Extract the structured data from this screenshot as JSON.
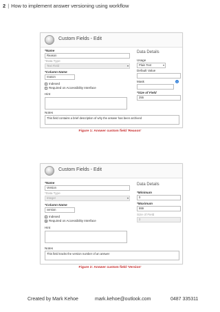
{
  "header": {
    "page_number": "2",
    "separator": "|",
    "title": "How to implement answer versioning using workflow"
  },
  "figures": [
    {
      "window_title": "Custom Fields - Edit",
      "name_label": "*Name",
      "name_value": "Reason",
      "data_type_label": "*Data Type",
      "data_type_value": "Text Field",
      "column_name_label": "*Column Name",
      "column_name_value": "reason",
      "indexed_label": "Indexed",
      "indexed_checked": false,
      "required_label": "Required on Accessibility Interface",
      "required_checked": false,
      "hint_label": "Hint",
      "hint_value": "",
      "notes_label": "Notes",
      "notes_value": "This field contains a brief description of why the answer has been archived",
      "data_details_title": "Data Details",
      "usage_label": "Usage",
      "usage_value": "Plain Text",
      "default_value_label": "Default Value",
      "default_value_value": "",
      "mask_label": "Mask",
      "mask_value": "",
      "mask_info_icon": "info-icon",
      "size_label": "*Size of Field",
      "size_value": "255",
      "caption": "Figure 1: Answer custom field 'Reason'"
    },
    {
      "window_title": "Custom Fields - Edit",
      "name_label": "*Name",
      "name_value": "Version",
      "data_type_label": "*Data Type",
      "data_type_value": "Integer",
      "column_name_label": "*Column Name",
      "column_name_value": "version",
      "indexed_label": "Indexed",
      "indexed_checked": false,
      "required_label": "Required on Accessibility Interface",
      "required_checked": true,
      "hint_label": "Hint",
      "hint_value": "",
      "notes_label": "Notes",
      "notes_value": "This field tracks the version number of an answer",
      "data_details_title": "Data Details",
      "minimum_label": "*Minimum",
      "minimum_value": "0",
      "maximum_label": "*Maximum",
      "maximum_value": "999",
      "size_label": "Size of Field",
      "size_value": "3",
      "caption": "Figure 2: Answer custom field 'Version'"
    }
  ],
  "footer": {
    "author": "Created by Mark Kehoe",
    "email": "mark.kehoe@outlook.com",
    "phone": "0487 335311"
  }
}
